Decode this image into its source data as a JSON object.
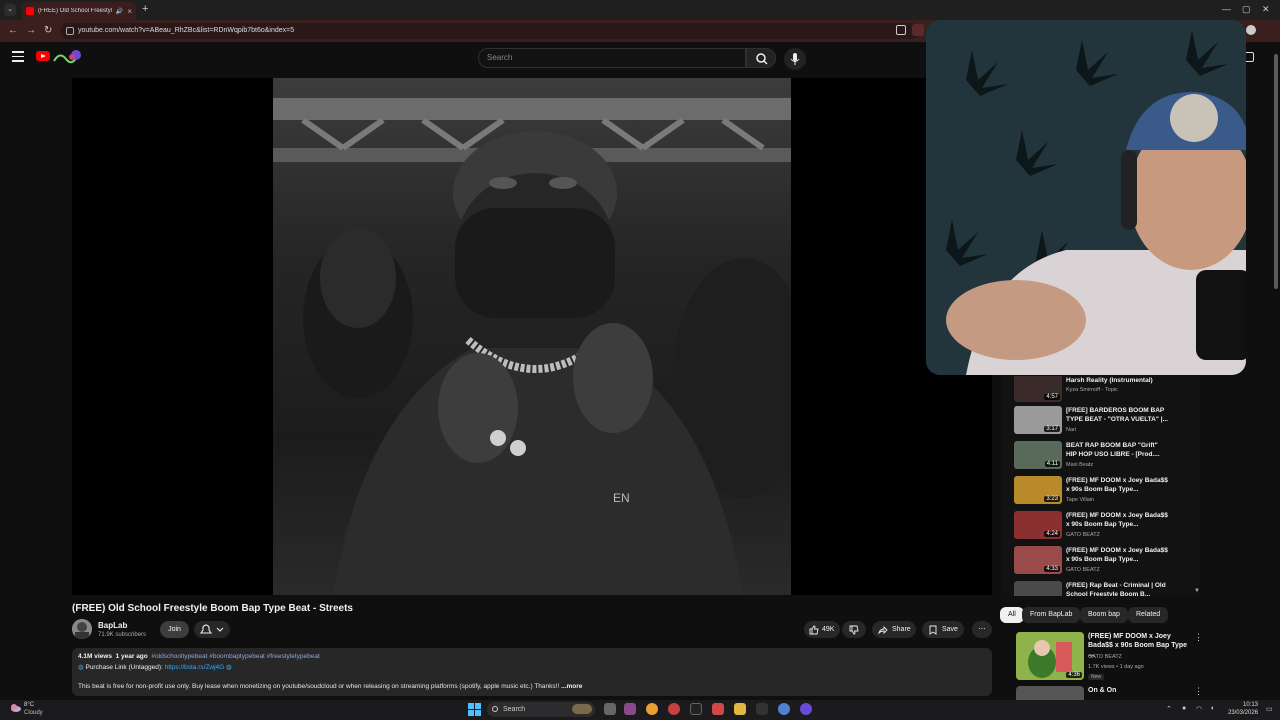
{
  "browser": {
    "tab_title": "(FREE) Old School Freestyle",
    "url": "youtube.com/watch?v=ABeau_RhZBc&list=RDnWqpib7bt6o&index=5",
    "new_tab": "+",
    "tab_close": "×"
  },
  "header": {
    "search_placeholder": "Search"
  },
  "video": {
    "title": "(FREE) Old School Freestyle Boom Bap Type Beat - Streets",
    "channel_name": "BapLab",
    "subscribers": "71.9K subscribers",
    "join_label": "Join",
    "like_count": "49K",
    "share_label": "Share",
    "save_label": "Save"
  },
  "description": {
    "views": "4.1M views",
    "age": "1 year ago",
    "hashtags": "#oldschooltypebeat #boombaptypebeat #freestyletypebeat",
    "purchase_prefix": "Purchase Link (Untagged):",
    "purchase_link": "https://bsta.rs/Zwj4G",
    "body": "This beat is free for non-profit use only. Buy lease when monetizing on youtube/soudcloud or when releasing on streaming platforms (spotify, apple music etc.) Thanks!!",
    "more": "...more"
  },
  "playlist": [
    {
      "title": "Harsh Reality (Instrumental)",
      "channel": "Kyza Smirnoff - Topic",
      "duration": "4:57"
    },
    {
      "title": "[FREE] BARDEROS BOOM BAP TYPE BEAT - \"OTRA VUELTA\" |...",
      "channel": "Nari",
      "duration": "3:17"
    },
    {
      "title": "BEAT RAP BOOM BAP \"Grift\" HIP HOP USO LIBRE - [Prod....",
      "channel": "Maxi Beatz",
      "duration": "4:11"
    },
    {
      "title": "(FREE) MF DOOM x Joey Bada$$ x 90s Boom Bap Type...",
      "channel": "Tape Villain",
      "duration": "3:23"
    },
    {
      "title": "(FREE) MF DOOM x Joey Bada$$ x 90s Boom Bap Type...",
      "channel": "GATO BEATZ",
      "duration": "4:24"
    },
    {
      "title": "(FREE) MF DOOM x Joey Bada$$ x 90s Boom Bap Type...",
      "channel": "GATO BEATZ",
      "duration": "4:33"
    },
    {
      "title": "(FREE) Rap Beat - Criminal | Old School Freestyle Boom B...",
      "channel": "",
      "duration": ""
    }
  ],
  "chips": [
    "All",
    "From BapLab",
    "Boom bap",
    "Related"
  ],
  "recommended": [
    {
      "title": "(FREE) MF DOOM x Joey Bada$$ x 90s Boom Bap Type ...",
      "channel": "GATO BEATZ",
      "meta": "1.7K views • 1 day ago",
      "badge": "New",
      "duration": "4:36"
    },
    {
      "title": "On & On"
    }
  ],
  "taskbar": {
    "temp": "8°C",
    "weather": "Cloudy",
    "search": "Search",
    "time": "10:13",
    "date": "23/03/2026"
  },
  "colors": {
    "background": "#0f0f0f",
    "address_bar": "#3b1f1f",
    "youtube_red": "#ff0000",
    "link_blue": "#3ea6ff",
    "chip_active": "#f1f1f1"
  },
  "icons": [
    "hamburger-menu-icon",
    "youtube-logo-icon",
    "search-icon",
    "microphone-icon",
    "cast-icon",
    "like-icon",
    "dislike-icon",
    "share-icon",
    "save-icon",
    "bell-icon",
    "windows-start-icon"
  ]
}
